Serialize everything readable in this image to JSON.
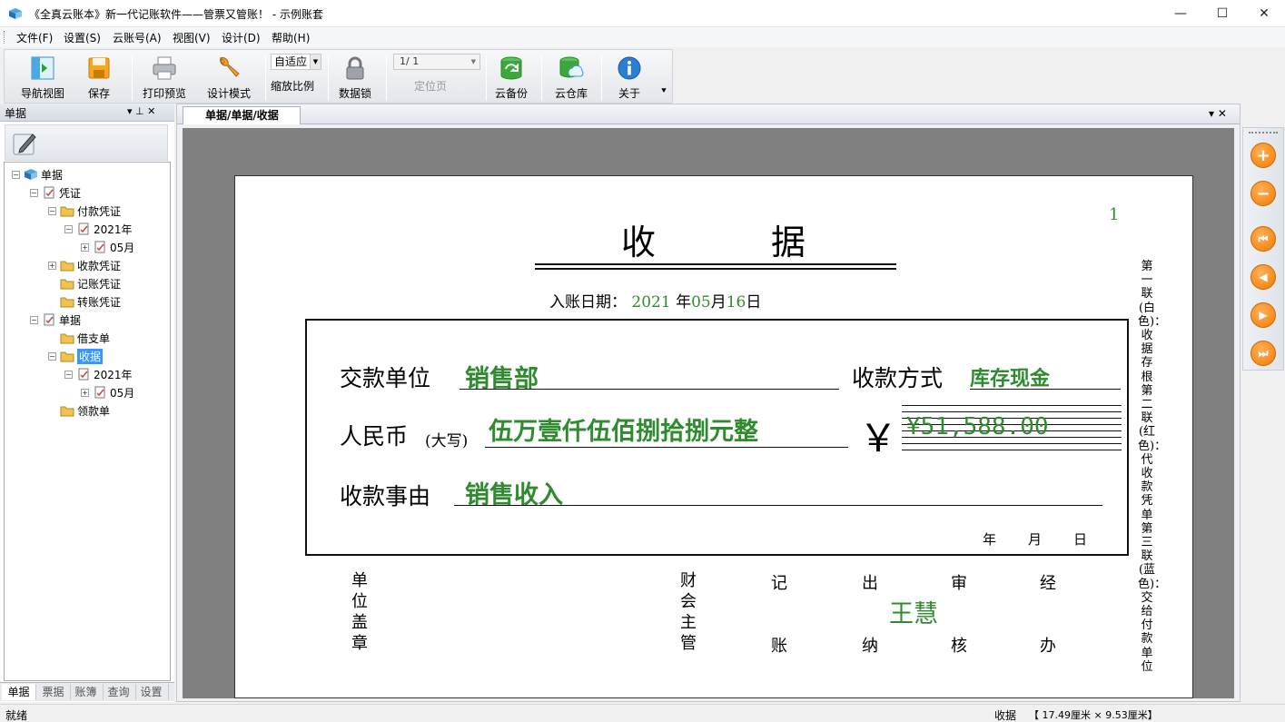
{
  "window": {
    "title": "《全真云账本》新一代记账软件——管票又管账！ - 示例账套",
    "minimize": "—",
    "maximize": "☐",
    "close": "✕"
  },
  "menu": [
    "文件(F)",
    "设置(S)",
    "云账号(A)",
    "视图(V)",
    "设计(D)",
    "帮助(H)"
  ],
  "toolbar": {
    "nav_view": "导航视图",
    "save": "保存",
    "print_preview": "打印预览",
    "design_mode": "设计模式",
    "zoom_value": "自适应",
    "zoom_label": "缩放比例",
    "data_lock": "数据锁",
    "page_value": "1/ 1",
    "locate_page": "定位页",
    "cloud_backup": "云备份",
    "cloud_repo": "云仓库",
    "about": "关于"
  },
  "left_panel": {
    "title": "单据",
    "pin": "▾  ⊥  ✕",
    "tree": [
      {
        "label": "单据",
        "exp": "⊟"
      },
      {
        "label": "凭证",
        "exp": "⊟"
      },
      {
        "label": "付款凭证",
        "exp": "⊟"
      },
      {
        "label": "2021年",
        "exp": "⊟"
      },
      {
        "label": "05月",
        "exp": "⊞"
      },
      {
        "label": "收款凭证",
        "exp": "⊞"
      },
      {
        "label": "记账凭证",
        "exp": ""
      },
      {
        "label": "转账凭证",
        "exp": ""
      },
      {
        "label": "单据",
        "exp": "⊟"
      },
      {
        "label": "借支单",
        "exp": ""
      },
      {
        "label": "收据",
        "exp": "⊟"
      },
      {
        "label": "2021年",
        "exp": "⊟"
      },
      {
        "label": "05月",
        "exp": "⊞"
      },
      {
        "label": "领款单",
        "exp": ""
      }
    ],
    "tabs": [
      "单据",
      "票据",
      "账簿",
      "查询",
      "设置"
    ]
  },
  "doc": {
    "tab_title": "单据/单据/收据",
    "tab_controls": "▾  ✕"
  },
  "receipt": {
    "page_number": "1",
    "title_left": "收",
    "title_right": "据",
    "date_label": "入账日期：",
    "date_year": "2021",
    "date_year_unit": "年",
    "date_month": "05",
    "date_month_unit": "月",
    "date_day": "16",
    "date_day_unit": "日",
    "payer_label": "交款单位",
    "payer_value": "销售部",
    "method_label": "收款方式",
    "method_value": "库存现金",
    "rmb_label": "人民币",
    "rmb_sub": "(大写)",
    "rmb_value": "伍万壹仟伍佰捌拾捌元整",
    "yen_symbol": "￥",
    "amount": "¥51,588.00",
    "reason_label": "收款事由",
    "reason_value": "销售收入",
    "ymd_year": "年",
    "ymd_month": "月",
    "ymd_day": "日",
    "seal_label": "单位盖章",
    "accounting_supervisor": "财会主管",
    "bookkeeper_top": "记",
    "bookkeeper_bottom": "账",
    "cashier_top": "出",
    "cashier_bottom": "纳",
    "reviewer_top": "审",
    "reviewer_bottom": "核",
    "handler_top": "经",
    "handler_bottom": "办",
    "reviewer_name": "王慧",
    "side_note": "第一联(白色)：收据存根 第二联(红色)：代收款凭单 第三联(蓝色)：交给付款单位"
  },
  "status": {
    "left": "就绪",
    "doc_name": "收据",
    "size": "【 17.49厘米  ×   9.53厘米】"
  }
}
